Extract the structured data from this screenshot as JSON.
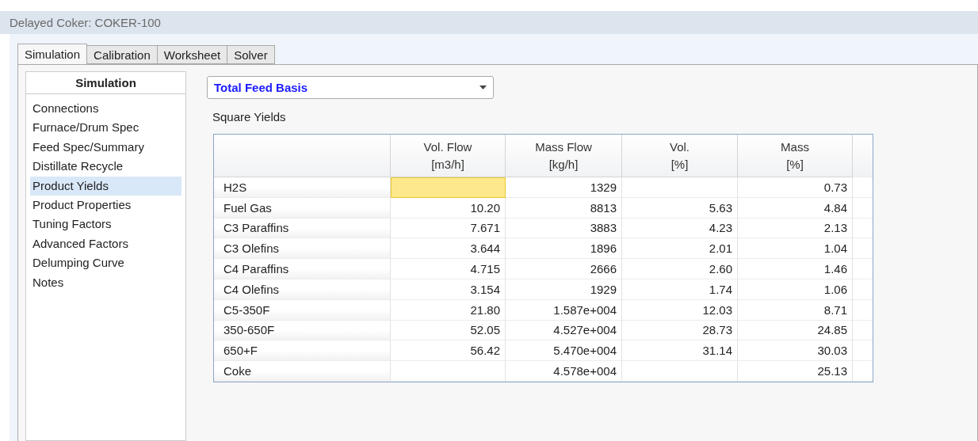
{
  "window": {
    "title": "Delayed Coker: COKER-100"
  },
  "tabs": [
    {
      "label": "Simulation",
      "selected": true
    },
    {
      "label": "Calibration",
      "selected": false
    },
    {
      "label": "Worksheet",
      "selected": false
    },
    {
      "label": "Solver",
      "selected": false
    }
  ],
  "sidebar": {
    "title": "Simulation",
    "items": [
      {
        "label": "Connections",
        "selected": false
      },
      {
        "label": "Furnace/Drum Spec",
        "selected": false
      },
      {
        "label": "Feed Spec/Summary",
        "selected": false
      },
      {
        "label": "Distillate Recycle",
        "selected": false
      },
      {
        "label": "Product Yields",
        "selected": true
      },
      {
        "label": "Product Properties",
        "selected": false
      },
      {
        "label": "Tuning Factors",
        "selected": false
      },
      {
        "label": "Advanced Factors",
        "selected": false
      },
      {
        "label": "Delumping Curve",
        "selected": false
      },
      {
        "label": "Notes",
        "selected": false
      }
    ]
  },
  "basis_dropdown": {
    "value": "Total Feed Basis"
  },
  "section_label": "Square Yields",
  "table": {
    "columns": [
      {
        "name": "Vol. Flow",
        "unit": "[m3/h]"
      },
      {
        "name": "Mass Flow",
        "unit": "[kg/h]"
      },
      {
        "name": "Vol.",
        "unit": "[%]"
      },
      {
        "name": "Mass",
        "unit": "[%]"
      }
    ],
    "rows": [
      {
        "label": "H2S",
        "cells": [
          {
            "selected": true
          },
          {
            "text": "1329",
            "selected": false
          },
          {
            "selected": false
          },
          {
            "text": "0.73",
            "selected": false
          }
        ]
      },
      {
        "label": "Fuel Gas",
        "cells": [
          {
            "text": "10.20",
            "selected": false
          },
          {
            "text": "8813",
            "selected": false
          },
          {
            "text": "5.63",
            "selected": false
          },
          {
            "text": "4.84",
            "selected": false
          }
        ]
      },
      {
        "label": "C3 Paraffins",
        "cells": [
          {
            "text": "7.671",
            "selected": false
          },
          {
            "text": "3883",
            "selected": false
          },
          {
            "text": "4.23",
            "selected": false
          },
          {
            "text": "2.13",
            "selected": false
          }
        ]
      },
      {
        "label": "C3 Olefins",
        "cells": [
          {
            "text": "3.644",
            "selected": false
          },
          {
            "text": "1896",
            "selected": false
          },
          {
            "text": "2.01",
            "selected": false
          },
          {
            "text": "1.04",
            "selected": false
          }
        ]
      },
      {
        "label": "C4 Paraffins",
        "cells": [
          {
            "text": "4.715",
            "selected": false
          },
          {
            "text": "2666",
            "selected": false
          },
          {
            "text": "2.60",
            "selected": false
          },
          {
            "text": "1.46",
            "selected": false
          }
        ]
      },
      {
        "label": "C4 Olefins",
        "cells": [
          {
            "text": "3.154",
            "selected": false
          },
          {
            "text": "1929",
            "selected": false
          },
          {
            "text": "1.74",
            "selected": false
          },
          {
            "text": "1.06",
            "selected": false
          }
        ]
      },
      {
        "label": "C5-350F",
        "cells": [
          {
            "text": "21.80",
            "selected": false
          },
          {
            "text": "1.587e+004",
            "selected": false
          },
          {
            "text": "12.03",
            "selected": false
          },
          {
            "text": "8.71",
            "selected": false
          }
        ]
      },
      {
        "label": "350-650F",
        "cells": [
          {
            "text": "52.05",
            "selected": false
          },
          {
            "text": "4.527e+004",
            "selected": false
          },
          {
            "text": "28.73",
            "selected": false
          },
          {
            "text": "24.85",
            "selected": false
          }
        ]
      },
      {
        "label": "650+F",
        "cells": [
          {
            "text": "56.42",
            "selected": false
          },
          {
            "text": "5.470e+004",
            "selected": false
          },
          {
            "text": "31.14",
            "selected": false
          },
          {
            "text": "30.03",
            "selected": false
          }
        ]
      },
      {
        "label": "Coke",
        "cells": [
          {
            "selected": false
          },
          {
            "text": "4.578e+004",
            "selected": false
          },
          {
            "selected": false
          },
          {
            "text": "25.13",
            "selected": false
          }
        ]
      }
    ]
  }
}
